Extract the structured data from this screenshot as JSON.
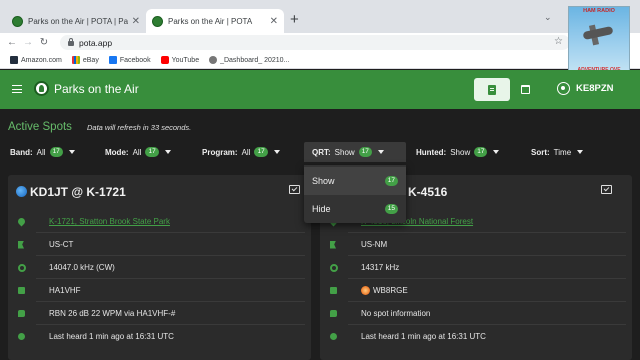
{
  "browser": {
    "tabs": [
      {
        "title": "Parks on the Air | POTA | Parks pa",
        "active": false
      },
      {
        "title": "Parks on the Air | POTA",
        "active": true
      }
    ],
    "url": "pota.app",
    "bookmarks": [
      "Amazon.com",
      "eBay",
      "Facebook",
      "YouTube",
      "_Dashboard_ 20210..."
    ]
  },
  "thumbnail": {
    "top_text": "HAM RADIO",
    "bottom_text": "ADVENTURE OVE"
  },
  "app": {
    "title": "Parks on the Air",
    "callsign": "KE8PZN"
  },
  "spots": {
    "heading": "Active Spots",
    "refresh_note": "Data will refresh in 33 seconds."
  },
  "filters": {
    "band": {
      "label": "Band:",
      "value": "All",
      "count": "17"
    },
    "mode": {
      "label": "Mode:",
      "value": "All",
      "count": "17"
    },
    "program": {
      "label": "Program:",
      "value": "All",
      "count": "17"
    },
    "qrt": {
      "label": "QRT:",
      "value": "Show",
      "count": "17"
    },
    "hunted": {
      "label": "Hunted:",
      "value": "Show",
      "count": "17"
    },
    "sort": {
      "label": "Sort:",
      "value": "Time"
    }
  },
  "qrt_menu": [
    {
      "label": "Show",
      "count": "17",
      "selected": true
    },
    {
      "label": "Hide",
      "count": "15",
      "selected": false
    }
  ],
  "cards": [
    {
      "title": "KD1JT @ K-1721",
      "park": "K-1721, Stratton Brook State Park",
      "location": "US-CT",
      "frequency": "14047.0 kHz (CW)",
      "hunter": "HA1VHF",
      "comment": "RBN 26 dB 22 WPM via HA1VHF-#",
      "heard": "Last heard 1 min ago at 16:31 UTC"
    },
    {
      "title": "K-4516",
      "park": "K-4516, Lincoln National Forest",
      "location": "US-NM",
      "frequency": "14317 kHz",
      "hunter": "WB8RGE",
      "comment": "No spot information",
      "heard": "Last heard 1 min ago at 16:31 UTC"
    }
  ],
  "colors": {
    "brand_green": "#388e3c",
    "accent_green": "#43a047",
    "background": "#1e1e1e"
  }
}
